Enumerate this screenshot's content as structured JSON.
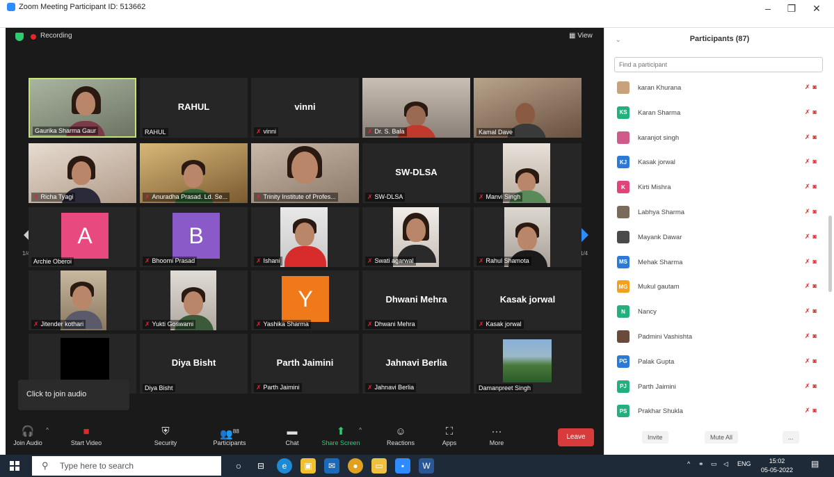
{
  "window": {
    "title": "Zoom Meeting Participant ID: 513662"
  },
  "topbar": {
    "recording": "Recording",
    "view": "View"
  },
  "gallery": {
    "page_left": "1/4",
    "page_right": "1/4",
    "tiles": [
      {
        "name": "Gaurika Sharma Gaur",
        "center": ""
      },
      {
        "name": "RAHUL",
        "center": "RAHUL"
      },
      {
        "name": "vinni",
        "center": "vinni"
      },
      {
        "name": "Dr. S. Bala",
        "center": ""
      },
      {
        "name": "Kamal Dave",
        "center": ""
      },
      {
        "name": "Richa Tyagi",
        "center": ""
      },
      {
        "name": "Anuradha Prasad. Ld. Se...",
        "center": ""
      },
      {
        "name": "Trinity Institute of Profes...",
        "center": ""
      },
      {
        "name": "SW-DLSA",
        "center": "SW-DLSA"
      },
      {
        "name": "Manvi Singh",
        "center": ""
      },
      {
        "name": "Archie Oberoi",
        "center": "",
        "avatar": "A"
      },
      {
        "name": "Bhoomi Prasad",
        "center": "",
        "avatar": "B"
      },
      {
        "name": "Ishani",
        "center": ""
      },
      {
        "name": "Swati agarwal",
        "center": ""
      },
      {
        "name": "Rahul Shamota",
        "center": ""
      },
      {
        "name": "Jitender kothari",
        "center": ""
      },
      {
        "name": "Yukti Goswami",
        "center": ""
      },
      {
        "name": "Yashika Sharma",
        "center": "",
        "avatar": "Y"
      },
      {
        "name": "Dhwani Mehra",
        "center": "Dhwani Mehra"
      },
      {
        "name": "Kasak jorwal",
        "center": "Kasak jorwal"
      },
      {
        "name": "",
        "center": ""
      },
      {
        "name": "Diya Bisht",
        "center": "Diya Bisht"
      },
      {
        "name": "Parth Jaimini",
        "center": "Parth Jaimini"
      },
      {
        "name": "Jahnavi Berlia",
        "center": "Jahnavi Berlia"
      },
      {
        "name": "Damanpreet Singh",
        "center": ""
      }
    ]
  },
  "join_popup": {
    "text": "Click to join audio"
  },
  "controls": {
    "join_audio": "Join Audio",
    "start_video": "Start Video",
    "security": "Security",
    "participants": "Participants",
    "participants_count": "88",
    "chat": "Chat",
    "share_screen": "Share Screen",
    "reactions": "Reactions",
    "apps": "Apps",
    "more": "More",
    "leave": "Leave"
  },
  "panel": {
    "title": "Participants (87)",
    "search_placeholder": "Find a participant",
    "participants": [
      {
        "initials": "",
        "name": "karan Khurana",
        "color": "#c9a27a"
      },
      {
        "initials": "KS",
        "name": "Karan Sharma",
        "color": "#23b07d"
      },
      {
        "initials": "",
        "name": "karanjot singh",
        "color": "#d05a8a"
      },
      {
        "initials": "KJ",
        "name": "Kasak jorwal",
        "color": "#2d7ad6"
      },
      {
        "initials": "K",
        "name": "Kirti Mishra",
        "color": "#e0447a"
      },
      {
        "initials": "",
        "name": "Labhya Sharma",
        "color": "#7a6a5a"
      },
      {
        "initials": "",
        "name": "Mayank Dawar",
        "color": "#4a4a4a"
      },
      {
        "initials": "MS",
        "name": "Mehak Sharma",
        "color": "#2d7ad6"
      },
      {
        "initials": "MG",
        "name": "Mukul gautam",
        "color": "#f0a21e"
      },
      {
        "initials": "N",
        "name": "Nancy",
        "color": "#23b07d"
      },
      {
        "initials": "",
        "name": "Padmini Vashishta",
        "color": "#6a4a3a"
      },
      {
        "initials": "PG",
        "name": "Palak Gupta",
        "color": "#2d7ad6"
      },
      {
        "initials": "PJ",
        "name": "Parth Jaimini",
        "color": "#23b07d"
      },
      {
        "initials": "PS",
        "name": "Prakhar Shukla",
        "color": "#23b07d"
      }
    ],
    "invite": "Invite",
    "mute_all": "Mute All",
    "more": "..."
  },
  "taskbar": {
    "search_placeholder": "Type here to search",
    "lang": "ENG",
    "time": "15:02",
    "date": "05-05-2022"
  },
  "colors": {
    "zoom_blue": "#2d8cff",
    "leave_red": "#d83b3b",
    "active_border": "#c6e377"
  }
}
